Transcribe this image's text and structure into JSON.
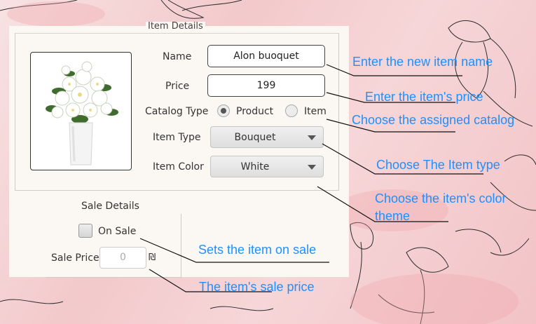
{
  "form": {
    "legend": "Item Details",
    "name_label": "Name",
    "name_value": "Alon buoquet",
    "price_label": "Price",
    "price_value": "199",
    "catalog_label": "Catalog Type",
    "catalog_options": [
      "Product",
      "Item"
    ],
    "catalog_selected": "Product",
    "item_type_label": "Item Type",
    "item_type_value": "Bouquet",
    "item_color_label": "Item Color",
    "item_color_value": "White"
  },
  "sale": {
    "legend": "Sale Details",
    "on_sale_label": "On Sale",
    "on_sale_checked": false,
    "price_label": "Sale Price",
    "price_placeholder": "0",
    "currency_symbol": "₪"
  },
  "annotations": {
    "name": "Enter the new item name",
    "price": "Enter the item's price",
    "catalog": "Choose the assigned catalog",
    "type": "Choose The Item type",
    "color": "Choose the item's color theme",
    "on_sale": "Sets the item on sale",
    "sale_price": "The item's sale price"
  },
  "colors": {
    "annotation_text": "#1e90ff",
    "background_pink": "#f3c9cb",
    "panel": "#fbf7f3"
  }
}
